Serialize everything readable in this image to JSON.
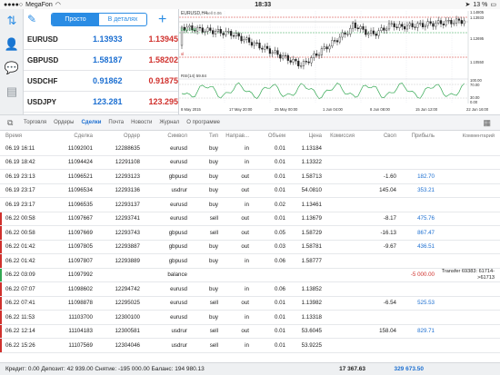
{
  "status_bar": {
    "carrier": "MegaFon",
    "time": "18:33",
    "battery": "13 %"
  },
  "toolbar": {
    "seg_simple": "Просто",
    "seg_detailed": "В деталях"
  },
  "quotes": [
    {
      "symbol": "EURUSD",
      "bid": "1.13933",
      "ask": "1.13945"
    },
    {
      "symbol": "GBPUSD",
      "bid": "1.58187",
      "ask": "1.58202"
    },
    {
      "symbol": "USDCHF",
      "bid": "0.91862",
      "ask": "0.91875"
    },
    {
      "symbol": "USDJPY",
      "bid": "123.281",
      "ask": "123.295"
    }
  ],
  "chart": {
    "header": "EURUSD,H4",
    "sell_label": "sell 0.06",
    "buy_label": "buy 0.30",
    "sl_label": "sl",
    "indicator_label": "RSI(14) 59.84",
    "price_labels": [
      "1.14805",
      "1.13933",
      "1.12695",
      "1.10550"
    ],
    "rsi_levels": [
      "100.00",
      "70.00",
      "30.00",
      "0.00"
    ],
    "date_labels": [
      "8 May 2015",
      "17 May 20:00",
      "25 May 00:00",
      "1 Jun 04:00",
      "8 Jun 08:00",
      "15 Jun 12:00",
      "22 Jun 16:00"
    ]
  },
  "tabs": [
    {
      "label": "Торговля",
      "active": false
    },
    {
      "label": "Ордеры",
      "active": false
    },
    {
      "label": "Сделки",
      "active": true
    },
    {
      "label": "Почта",
      "active": false
    },
    {
      "label": "Новости",
      "active": false
    },
    {
      "label": "Журнал",
      "active": false
    },
    {
      "label": "О программе",
      "active": false
    }
  ],
  "columns": {
    "time": "Время",
    "deal": "Сделка",
    "order": "Ордер",
    "symbol": "Символ",
    "type": "Тип",
    "direction": "Направ...",
    "volume": "Объем",
    "price": "Цена",
    "commission": "Комиссия",
    "swap": "Своп",
    "profit": "Прибыль",
    "comment": "Комментарий"
  },
  "deals": [
    {
      "time": "06.19 16:11",
      "deal": "11092001",
      "order": "12288635",
      "symbol": "eurusd",
      "type": "buy",
      "direction": "in",
      "volume": "0.01",
      "price": "1.13184",
      "commission": "",
      "swap": "",
      "profit": "",
      "comment": "",
      "mark": ""
    },
    {
      "time": "06.19 18:42",
      "deal": "11094424",
      "order": "12291108",
      "symbol": "eurusd",
      "type": "buy",
      "direction": "in",
      "volume": "0.01",
      "price": "1.13322",
      "commission": "",
      "swap": "",
      "profit": "",
      "comment": "",
      "mark": ""
    },
    {
      "time": "06.19 23:13",
      "deal": "11096521",
      "order": "12293123",
      "symbol": "gbpusd",
      "type": "buy",
      "direction": "out",
      "volume": "0.01",
      "price": "1.58713",
      "commission": "",
      "swap": "-1.60",
      "profit": "182.70",
      "comment": "",
      "mark": ""
    },
    {
      "time": "06.19 23:17",
      "deal": "11096534",
      "order": "12293136",
      "symbol": "usdrur",
      "type": "buy",
      "direction": "out",
      "volume": "0.01",
      "price": "54.0810",
      "commission": "",
      "swap": "145.04",
      "profit": "353.21",
      "comment": "",
      "mark": ""
    },
    {
      "time": "06.19 23:17",
      "deal": "11096535",
      "order": "12293137",
      "symbol": "eurusd",
      "type": "buy",
      "direction": "in",
      "volume": "0.02",
      "price": "1.13461",
      "commission": "",
      "swap": "",
      "profit": "",
      "comment": "",
      "mark": ""
    },
    {
      "time": "06.22 00:58",
      "deal": "11097667",
      "order": "12293741",
      "symbol": "eurusd",
      "type": "sell",
      "direction": "out",
      "volume": "0.01",
      "price": "1.13679",
      "commission": "",
      "swap": "-8.17",
      "profit": "475.76",
      "comment": "",
      "mark": "#d0312d"
    },
    {
      "time": "06.22 00:58",
      "deal": "11097669",
      "order": "12293743",
      "symbol": "gbpusd",
      "type": "sell",
      "direction": "out",
      "volume": "0.05",
      "price": "1.58729",
      "commission": "",
      "swap": "-16.13",
      "profit": "867.47",
      "comment": "",
      "mark": "#d0312d"
    },
    {
      "time": "06.22 01:42",
      "deal": "11097805",
      "order": "12293887",
      "symbol": "gbpusd",
      "type": "buy",
      "direction": "out",
      "volume": "0.03",
      "price": "1.58781",
      "commission": "",
      "swap": "-9.67",
      "profit": "436.51",
      "comment": "",
      "mark": "#d0312d"
    },
    {
      "time": "06.22 01:42",
      "deal": "11097807",
      "order": "12293889",
      "symbol": "gbpusd",
      "type": "buy",
      "direction": "in",
      "volume": "0.06",
      "price": "1.58777",
      "commission": "",
      "swap": "",
      "profit": "",
      "comment": "",
      "mark": "#d0312d"
    },
    {
      "time": "06.22 03:09",
      "deal": "11097992",
      "order": "",
      "symbol": "balance",
      "type": "",
      "direction": "",
      "volume": "",
      "price": "",
      "commission": "",
      "swap": "",
      "profit": "-5 000.00",
      "comment": "Transfer 69383: 61714->61713",
      "mark": "#33a852"
    },
    {
      "time": "06.22 07:07",
      "deal": "11098602",
      "order": "12294742",
      "symbol": "eurusd",
      "type": "buy",
      "direction": "in",
      "volume": "0.06",
      "price": "1.13852",
      "commission": "",
      "swap": "",
      "profit": "",
      "comment": "",
      "mark": "#d0312d"
    },
    {
      "time": "06.22 07:41",
      "deal": "11098878",
      "order": "12295025",
      "symbol": "eurusd",
      "type": "sell",
      "direction": "out",
      "volume": "0.01",
      "price": "1.13982",
      "commission": "",
      "swap": "-6.54",
      "profit": "525.53",
      "comment": "",
      "mark": "#d0312d"
    },
    {
      "time": "06.22 11:53",
      "deal": "11103700",
      "order": "12300100",
      "symbol": "eurusd",
      "type": "buy",
      "direction": "in",
      "volume": "0.01",
      "price": "1.13318",
      "commission": "",
      "swap": "",
      "profit": "",
      "comment": "",
      "mark": "#d0312d"
    },
    {
      "time": "06.22 12:14",
      "deal": "11104183",
      "order": "12300581",
      "symbol": "usdrur",
      "type": "sell",
      "direction": "out",
      "volume": "0.01",
      "price": "53.6045",
      "commission": "",
      "swap": "158.04",
      "profit": "829.71",
      "comment": "",
      "mark": "#d0312d"
    },
    {
      "time": "06.22 15:26",
      "deal": "11107569",
      "order": "12304046",
      "symbol": "usdrur",
      "type": "sell",
      "direction": "in",
      "volume": "0.01",
      "price": "53.9225",
      "commission": "",
      "swap": "",
      "profit": "",
      "comment": "",
      "mark": "#d0312d"
    }
  ],
  "footer": {
    "summary": "Кредит: 0.00 Депозит: 42 939.00 Снятие: -195 000.00 Баланс: 194 980.13",
    "commission_total": "17 367.63",
    "profit_total": "329 673.50"
  }
}
